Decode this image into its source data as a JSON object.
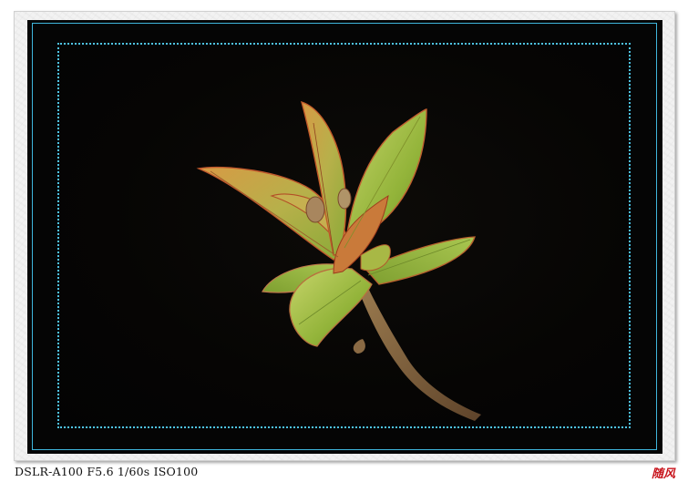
{
  "photo": {
    "subject": "leaf-bud-sprig",
    "exif_caption": "DSLR-A100 F5.6 1/60s ISO100",
    "signature": "随风"
  },
  "frame": {
    "mat_color": "#050505",
    "accent_line_color": "#3fb6dc",
    "paper_color": "#f2f2f2"
  },
  "colors": {
    "leaf_green": "#9fbf3a",
    "leaf_edge_red": "#b8502a",
    "stem_brown": "#7a5a3a",
    "signature_red": "#c8141c"
  }
}
